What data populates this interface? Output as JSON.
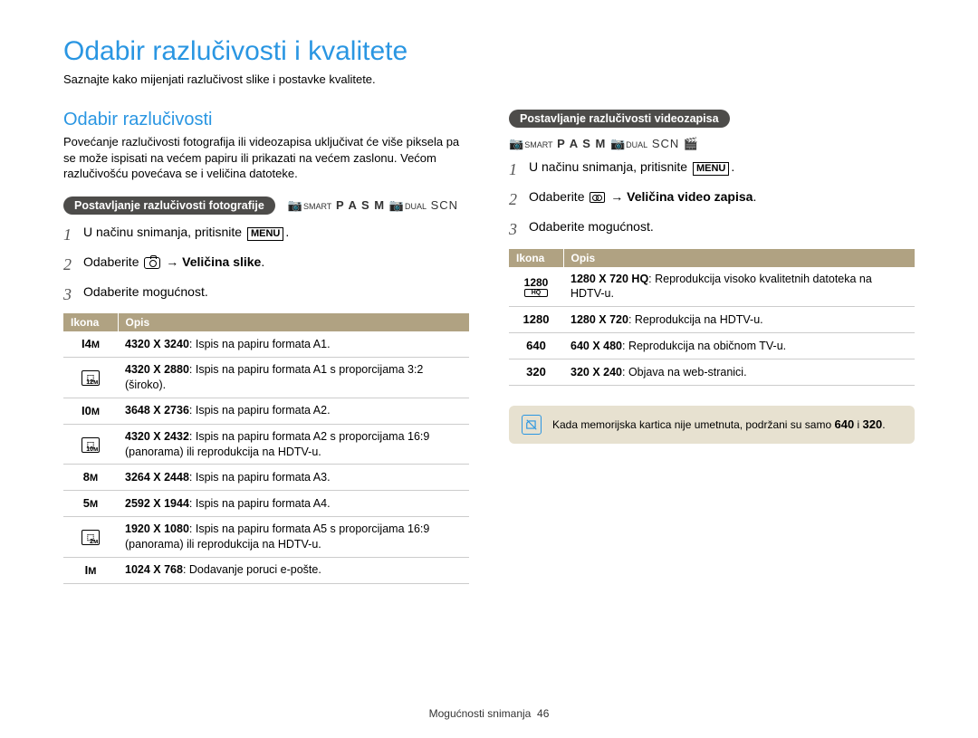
{
  "header": {
    "title": "Odabir razlučivosti i kvalitete",
    "subtitle": "Saznajte kako mijenjati razlučivost slike i postavke kvalitete."
  },
  "left": {
    "section_title": "Odabir razlučivosti",
    "section_desc": "Povećanje razlučivosti fotografija ili videozapisa uključivat će više piksela pa se može ispisati na većem papiru ili prikazati na većem zaslonu. Većom razlučivošću povećava se i veličina datoteke.",
    "pill": "Postavljanje razlučivosti fotografije",
    "modes": "P A S M",
    "mode_smart": "SMART",
    "mode_dual": "DUAL",
    "mode_scn": "SCN",
    "steps": {
      "1_prefix": "U načinu snimanja, pritisnite ",
      "1_menu": "MENU",
      "1_suffix": ".",
      "2_prefix": "Odaberite ",
      "2_arrow": " → ",
      "2_bold": "Veličina slike",
      "2_suffix": ".",
      "3": "Odaberite mogućnost."
    },
    "table": {
      "h1": "Ikona",
      "h2": "Opis",
      "rows": [
        {
          "icon": "14m",
          "res": "4320 X 3240",
          "desc": ": Ispis na papiru formata A1."
        },
        {
          "icon": "12m-wide",
          "res": "4320 X 2880",
          "desc": ": Ispis na papiru formata A1 s proporcijama 3:2 (široko)."
        },
        {
          "icon": "10m",
          "res": "3648 X 2736",
          "desc": ": Ispis na papiru formata A2."
        },
        {
          "icon": "10m-wide",
          "res": "4320 X 2432",
          "desc": ": Ispis na papiru formata A2 s proporcijama 16:9 (panorama) ili reprodukcija na HDTV-u."
        },
        {
          "icon": "8m",
          "res": "3264 X 2448",
          "desc": ": Ispis na papiru formata A3."
        },
        {
          "icon": "5m",
          "res": "2592 X 1944",
          "desc": ": Ispis na papiru formata A4."
        },
        {
          "icon": "2m-wide",
          "res": "1920 X 1080",
          "desc": ": Ispis na papiru formata A5 s proporcijama 16:9 (panorama) ili reprodukcija na HDTV-u."
        },
        {
          "icon": "1m",
          "res": "1024 X 768",
          "desc": ": Dodavanje poruci e-pošte."
        }
      ]
    }
  },
  "right": {
    "pill": "Postavljanje razlučivosti videozapisa",
    "modes": "P A S M",
    "mode_smart": "SMART",
    "mode_dual": "DUAL",
    "mode_scn": "SCN",
    "steps": {
      "1_prefix": "U načinu snimanja, pritisnite ",
      "1_menu": "MENU",
      "1_suffix": ".",
      "2_prefix": "Odaberite ",
      "2_arrow": " → ",
      "2_bold": "Veličina video zapisa",
      "2_suffix": ".",
      "3": "Odaberite mogućnost."
    },
    "table": {
      "h1": "Ikona",
      "h2": "Opis",
      "rows": [
        {
          "icon": "1280HQ",
          "res": "1280 X 720 HQ",
          "desc": ": Reprodukcija visoko kvalitetnih datoteka na HDTV-u."
        },
        {
          "icon": "1280",
          "res": "1280 X 720",
          "desc": ": Reprodukcija na HDTV-u."
        },
        {
          "icon": "640",
          "res": "640 X 480",
          "desc": ": Reprodukcija na običnom TV-u."
        },
        {
          "icon": "320",
          "res": "320 X 240",
          "desc": ": Objava na web-stranici."
        }
      ]
    },
    "note_prefix": "Kada memorijska kartica nije umetnuta, podržani su samo ",
    "note_mid": " i ",
    "note_suffix": ".",
    "note_icon1": "640",
    "note_icon2": "320"
  },
  "footer": {
    "section": "Mogućnosti snimanja",
    "page": "46"
  }
}
